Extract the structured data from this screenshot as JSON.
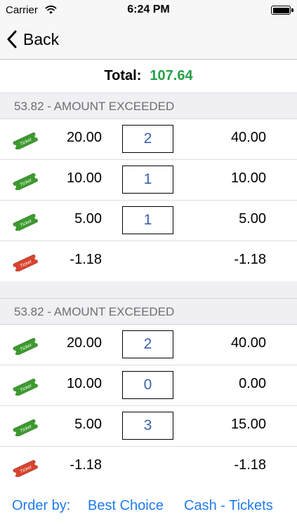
{
  "status_bar": {
    "carrier": "Carrier",
    "time": "6:24 PM"
  },
  "nav": {
    "back_label": "Back"
  },
  "total": {
    "label": "Total:",
    "value": "107.64"
  },
  "colors": {
    "accent": "#1f7bf0",
    "total_value": "#26a047",
    "qty_text": "#3862ac",
    "ticket_green": "#3c9a2e",
    "ticket_red": "#d8432e"
  },
  "sections": [
    {
      "header": "53.82 - AMOUNT EXCEEDED",
      "rows": [
        {
          "ticket": "green",
          "ticket_text": "Ticket",
          "denomination": "20.00",
          "quantity": "2",
          "amount": "40.00"
        },
        {
          "ticket": "green",
          "ticket_text": "Ticket",
          "denomination": "10.00",
          "quantity": "1",
          "amount": "10.00"
        },
        {
          "ticket": "green",
          "ticket_text": "Ticket",
          "denomination": "5.00",
          "quantity": "1",
          "amount": "5.00"
        },
        {
          "ticket": "red",
          "ticket_text": "Ticket",
          "denomination": "-1.18",
          "quantity": "",
          "amount": "-1.18"
        }
      ]
    },
    {
      "header": "53.82 - AMOUNT EXCEEDED",
      "rows": [
        {
          "ticket": "green",
          "ticket_text": "Ticket",
          "denomination": "20.00",
          "quantity": "2",
          "amount": "40.00"
        },
        {
          "ticket": "green",
          "ticket_text": "Ticket",
          "denomination": "10.00",
          "quantity": "0",
          "amount": "0.00"
        },
        {
          "ticket": "green",
          "ticket_text": "Ticket",
          "denomination": "5.00",
          "quantity": "3",
          "amount": "15.00"
        },
        {
          "ticket": "red",
          "ticket_text": "Ticket",
          "denomination": "-1.18",
          "quantity": "",
          "amount": "-1.18"
        }
      ]
    }
  ],
  "footer": {
    "order_by_label": "Order by:",
    "option_best_choice": "Best Choice",
    "option_cash_tickets": "Cash - Tickets"
  },
  "icons": {
    "ticket": "ticket-icon",
    "back": "chevron-left-icon",
    "wifi": "wifi-icon",
    "battery": "battery-icon"
  }
}
